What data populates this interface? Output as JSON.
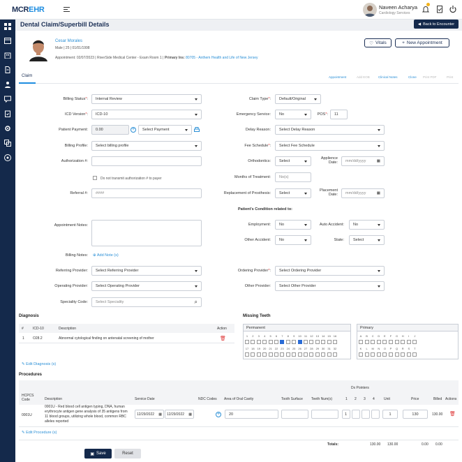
{
  "app": {
    "logo_prefix": "MCR",
    "logo_suffix": "EHR"
  },
  "user": {
    "name": "Naveen Acharya",
    "role": "Cardiology Services"
  },
  "page": {
    "title": "Dental Claim/Superbill Details",
    "back_label": "Back to Encounter"
  },
  "patient": {
    "name": "Cesar Morales",
    "info": "Male | 25 | 01/01/1998",
    "appointment_prefix": "Appointment: 02/07/2023 | RiverSide Medical Center - Exam Room 1 |",
    "primary_label": "Primary Ins:",
    "primary_value": "80705 - Anthem Health and Life of New Jersey"
  },
  "buttons": {
    "vitals": "Vitals",
    "new_appointment": "New Appointment",
    "save": "Save",
    "reset": "Reset"
  },
  "tabs": {
    "claim": "Claim"
  },
  "actions": [
    {
      "label": "Appointment",
      "enabled": true
    },
    {
      "label": "Add EOB",
      "enabled": false
    },
    {
      "label": "Clinical Notes",
      "enabled": true
    },
    {
      "label": "Clone",
      "enabled": true
    },
    {
      "label": "Print PDF",
      "enabled": false
    },
    {
      "label": "Print",
      "enabled": false
    }
  ],
  "form": {
    "billing_status": {
      "label": "Billing Status",
      "value": "Internal Review"
    },
    "icd_version": {
      "label": "ICD Version",
      "value": "ICD-10"
    },
    "patient_payment": {
      "label": "Patient Payment:",
      "value": "0.00",
      "select": "Select Payment"
    },
    "billing_profile": {
      "label": "Billing Profile:",
      "value": "Select billing profile"
    },
    "authorization": {
      "label": "Authorization #:",
      "value": ""
    },
    "no_transmit": "Do not transmit authorization # to payer",
    "referral": {
      "label": "Referral #:",
      "placeholder": "####"
    },
    "appointment_notes": {
      "label": "Appointment Notes:"
    },
    "billing_notes": {
      "label": "Billing Notes:",
      "add": "Add Note (s)"
    },
    "referring_provider": {
      "label": "Referring Provider:",
      "value": "Select Referring Provider"
    },
    "operating_provider": {
      "label": "Operating Provider:",
      "value": "Select Operating Provider"
    },
    "speciality_code": {
      "label": "Speciality Code:",
      "placeholder": "Select Speciality"
    },
    "claim_type": {
      "label": "Claim Type",
      "value": "Default/Original"
    },
    "emergency_service": {
      "label": "Emergency Service:",
      "value": "No"
    },
    "pos": {
      "label": "POS",
      "value": "11"
    },
    "delay_reason": {
      "label": "Delay Reason:",
      "value": "Select Delay Reason"
    },
    "fee_schedule": {
      "label": "Fee Schedule",
      "value": "Select Fee Schedule"
    },
    "orthodontics": {
      "label": "Orthodontics:",
      "value": "Select"
    },
    "appliance_date": {
      "label1": "Applience",
      "label2": "Date:",
      "placeholder": "mm/dd/yyyy"
    },
    "months_treatment": {
      "label": "Months of Treatment:",
      "placeholder": "No(s)"
    },
    "replacement": {
      "label": "Replacement of Prosthesis:",
      "value": "Select"
    },
    "placement_date": {
      "label1": "Placement",
      "label2": "Date:",
      "placeholder": "mm/dd/yyyy"
    },
    "condition_title": "Patient's Condition related to:",
    "employment": {
      "label": "Employment:",
      "value": "No"
    },
    "auto_accident": {
      "label": "Auto Accident:",
      "value": "No"
    },
    "other_accident": {
      "label": "Other Accident:",
      "value": "No"
    },
    "state": {
      "label": "State:",
      "value": "Select"
    },
    "ordering_provider": {
      "label": "Ordering Provider",
      "value": "Select Ordering Provider"
    },
    "other_provider": {
      "label": "Other Provider:",
      "value": "Select Other Provider"
    }
  },
  "diagnosis": {
    "title": "Diagnosis",
    "headers": [
      "#",
      "ICD-10",
      "Description",
      "Action"
    ],
    "rows": [
      {
        "num": "1",
        "code": "O28.2",
        "desc": "Abnormal cytological finding on antenatal screening of mother"
      }
    ],
    "edit": "Edit Diagnosis (s)"
  },
  "missing_teeth": {
    "title": "Missing Teeth",
    "permanent": "Permanent",
    "primary": "Primary",
    "perm_top": [
      "1",
      "2",
      "3",
      "4",
      "5",
      "6",
      "7",
      "8",
      "9",
      "10",
      "11",
      "12",
      "13",
      "14",
      "15",
      "16"
    ],
    "perm_bottom": [
      "17",
      "18",
      "19",
      "20",
      "21",
      "22",
      "23",
      "24",
      "25",
      "26",
      "27",
      "28",
      "29",
      "30",
      "31",
      "32"
    ],
    "perm_checked": [
      6,
      9
    ],
    "prim_top": [
      "A",
      "B",
      "C",
      "D",
      "E",
      "F",
      "G",
      "H",
      "I",
      "J"
    ],
    "prim_bottom": [
      "K",
      "L",
      "M",
      "N",
      "O",
      "P",
      "Q",
      "R",
      "S",
      "T"
    ]
  },
  "procedures": {
    "title": "Procedures",
    "dx_pointers": "Dx Pointers",
    "headers": {
      "code": "HCPCS Code",
      "desc": "Description",
      "service_date": "Service Date",
      "ndc": "NDC Codes",
      "area": "Area of Oral Cavity",
      "surface": "Tooth Surface",
      "teeth": "Teeth Num(s)",
      "p1": "1",
      "p2": "2",
      "p3": "3",
      "p4": "4",
      "unit": "Unit",
      "price": "Price",
      "billed": "Billed",
      "actions": "Actions"
    },
    "row": {
      "code": "0001U",
      "desc": "0001U - Red blood cell antigen typing, DNA, human erythrocyte antigen gene analysis of 35 antigens from 11 blood groups, utilizing whole blood, common RBC alleles reported",
      "date_from": "12/29/2022",
      "date_to": "12/29/2022",
      "area": "20",
      "p1": "1",
      "unit": "1",
      "price": "130",
      "billed": "130.00"
    },
    "edit": "Edit Procedure (s)",
    "totals": {
      "label": "Totals:",
      "t1": "130.00",
      "t2": "130.00",
      "t3": "0.00",
      "t4": "0.00"
    }
  }
}
